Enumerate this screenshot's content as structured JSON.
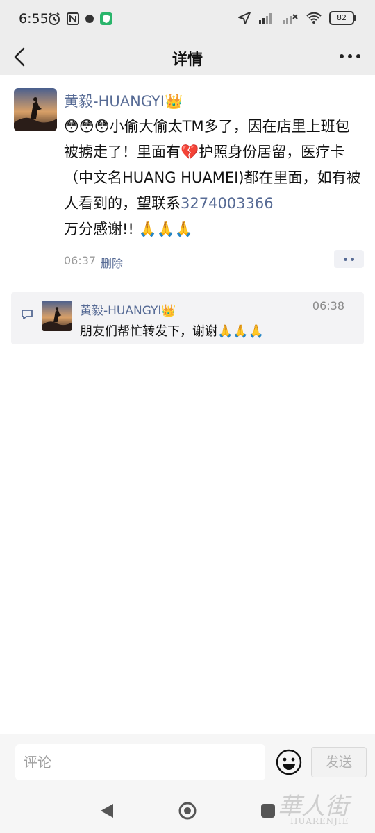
{
  "status_bar": {
    "time": "6:55",
    "battery": "82"
  },
  "nav": {
    "title": "详情"
  },
  "post": {
    "author": "黄毅-HUANGYI👑",
    "body_part1": "😳😳😳小偷大偷太TM多了，因在店里上班包被掳走了！里面有💔护照身份居留，医疗卡（中文名HUANG HUAMEI)都在里面，如有被人看到的，望联系",
    "phone": "3274003366",
    "body_part2": "万分感谢!! 🙏🙏🙏",
    "time": "06:37",
    "delete_label": "删除"
  },
  "comment": {
    "author": "黄毅-HUANGYI👑",
    "time": "06:38",
    "text": "朋友们帮忙转发下，谢谢🙏🙏🙏"
  },
  "input": {
    "placeholder": "评论",
    "send_label": "发送"
  },
  "watermark": {
    "text_big": "華人街",
    "text_small": "HUARENJIE"
  },
  "colors": {
    "link": "#576b95",
    "bar_bg": "#ededed"
  }
}
